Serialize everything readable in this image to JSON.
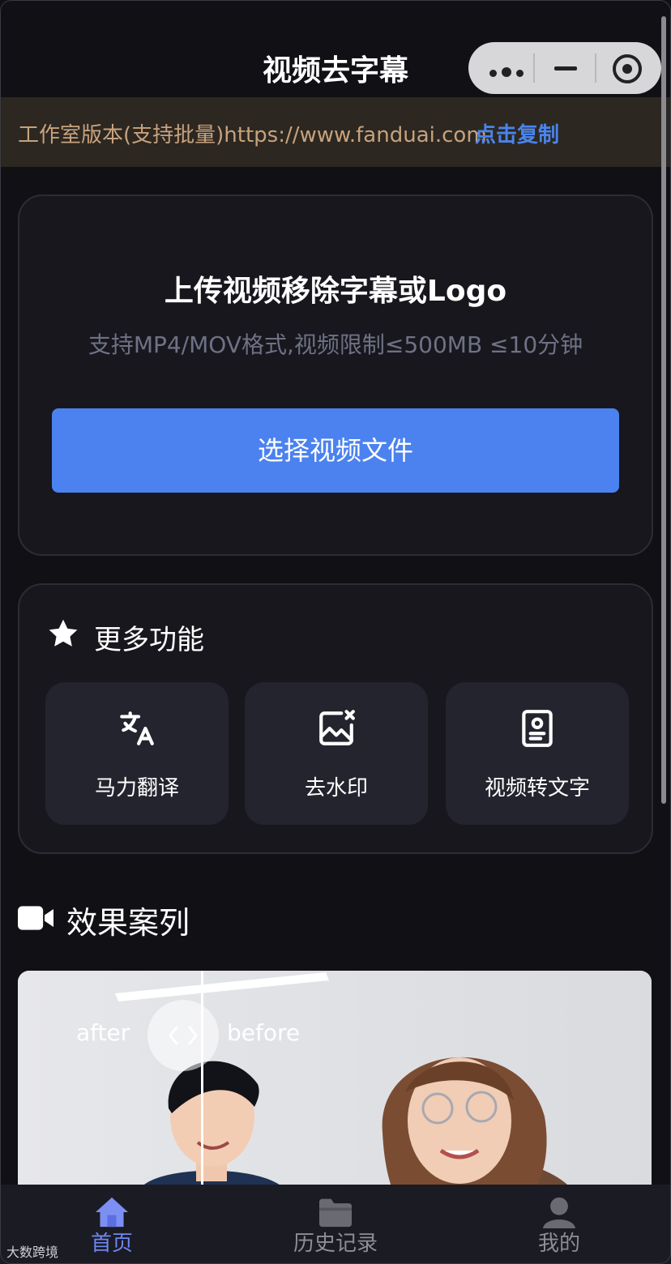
{
  "header": {
    "title": "视频去字幕"
  },
  "notice": {
    "text": "工作室版本(支持批量)https://www.fanduai.com",
    "link": "点击复制"
  },
  "upload": {
    "title": "上传视频移除字幕或Logo",
    "subtitle": "支持MP4/MOV格式,视频限制≤500MB ≤10分钟",
    "button": "选择视频文件"
  },
  "more": {
    "title": "更多功能",
    "items": [
      {
        "label": "马力翻译",
        "icon": "translate-icon"
      },
      {
        "label": "去水印",
        "icon": "image-remove-icon"
      },
      {
        "label": "视频转文字",
        "icon": "document-search-icon"
      }
    ]
  },
  "cases": {
    "title": "效果案列",
    "after": "after",
    "before": "before"
  },
  "tabbar": {
    "items": [
      {
        "label": "首页",
        "icon": "home-icon",
        "active": true
      },
      {
        "label": "历史记录",
        "icon": "folder-icon",
        "active": false
      },
      {
        "label": "我的",
        "icon": "user-icon",
        "active": false
      }
    ]
  },
  "watermark": "大数跨境",
  "colors": {
    "accent": "#4b82ef",
    "notice_text": "#c7a27e",
    "tab_active": "#6f86f0"
  }
}
